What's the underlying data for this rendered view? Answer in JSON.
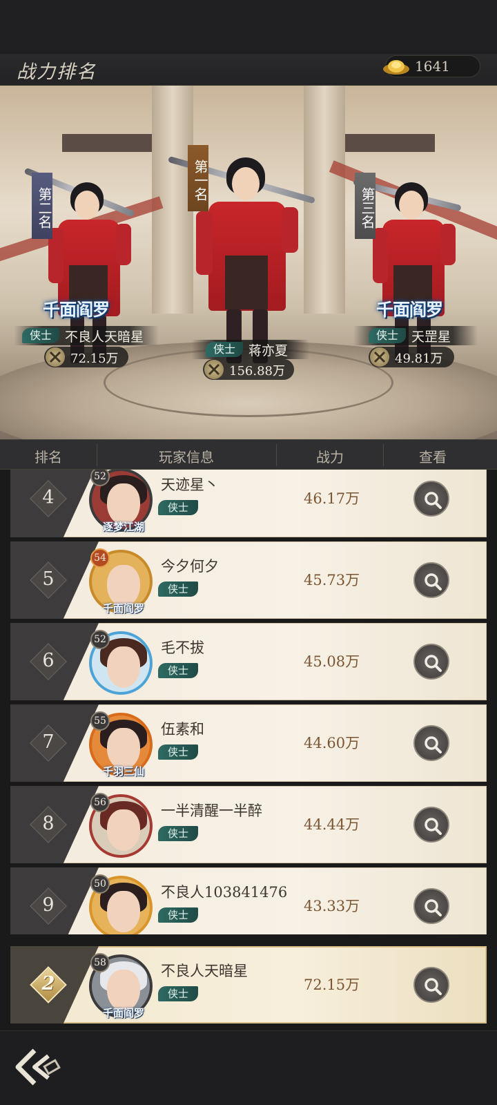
{
  "header": {
    "title": "战力排名",
    "currency_value": "1641",
    "currency_icon": "gold-ingot-icon"
  },
  "podium": {
    "first": {
      "rank_label": "第一名",
      "class": "侠士",
      "name": "蒋亦夏",
      "power": "156.88万"
    },
    "second": {
      "rank_label": "第二名",
      "guild": "千面阎罗",
      "class": "侠士",
      "name": "不良人天暗星",
      "power": "72.15万"
    },
    "third": {
      "rank_label": "第三名",
      "guild": "千面阎罗",
      "class": "侠士",
      "name": "天罡星",
      "power": "49.81万"
    }
  },
  "columns": {
    "rank": "排名",
    "player": "玩家信息",
    "power": "战力",
    "view": "查看"
  },
  "rows": [
    {
      "rank": "4",
      "level": "52",
      "frame_tag": "逐梦江湖",
      "name": "天迹星丶",
      "class": "侠士",
      "power": "46.17万"
    },
    {
      "rank": "5",
      "level": "54",
      "frame_tag": "千面阎罗",
      "name": "今夕何夕",
      "class": "侠士",
      "power": "45.73万"
    },
    {
      "rank": "6",
      "level": "52",
      "frame_tag": "",
      "name": "毛不拔",
      "class": "侠士",
      "power": "45.08万"
    },
    {
      "rank": "7",
      "level": "55",
      "frame_tag": "千羽三仙",
      "name": "伍素和",
      "class": "侠士",
      "power": "44.60万"
    },
    {
      "rank": "8",
      "level": "56",
      "frame_tag": "",
      "name": "一半清醒一半醉",
      "class": "侠士",
      "power": "44.44万"
    },
    {
      "rank": "9",
      "level": "50",
      "frame_tag": "",
      "name": "不良人103841476",
      "class": "侠士",
      "power": "43.33万"
    }
  ],
  "my_rank": {
    "rank": "2",
    "level": "58",
    "frame_tag": "千面阎罗",
    "name": "不良人天暗星",
    "class": "侠士",
    "power": "72.15万"
  },
  "colors": {
    "accent_gold": "#b18b42",
    "class_badge": "#2f6a63",
    "power_text": "#7b5532"
  }
}
